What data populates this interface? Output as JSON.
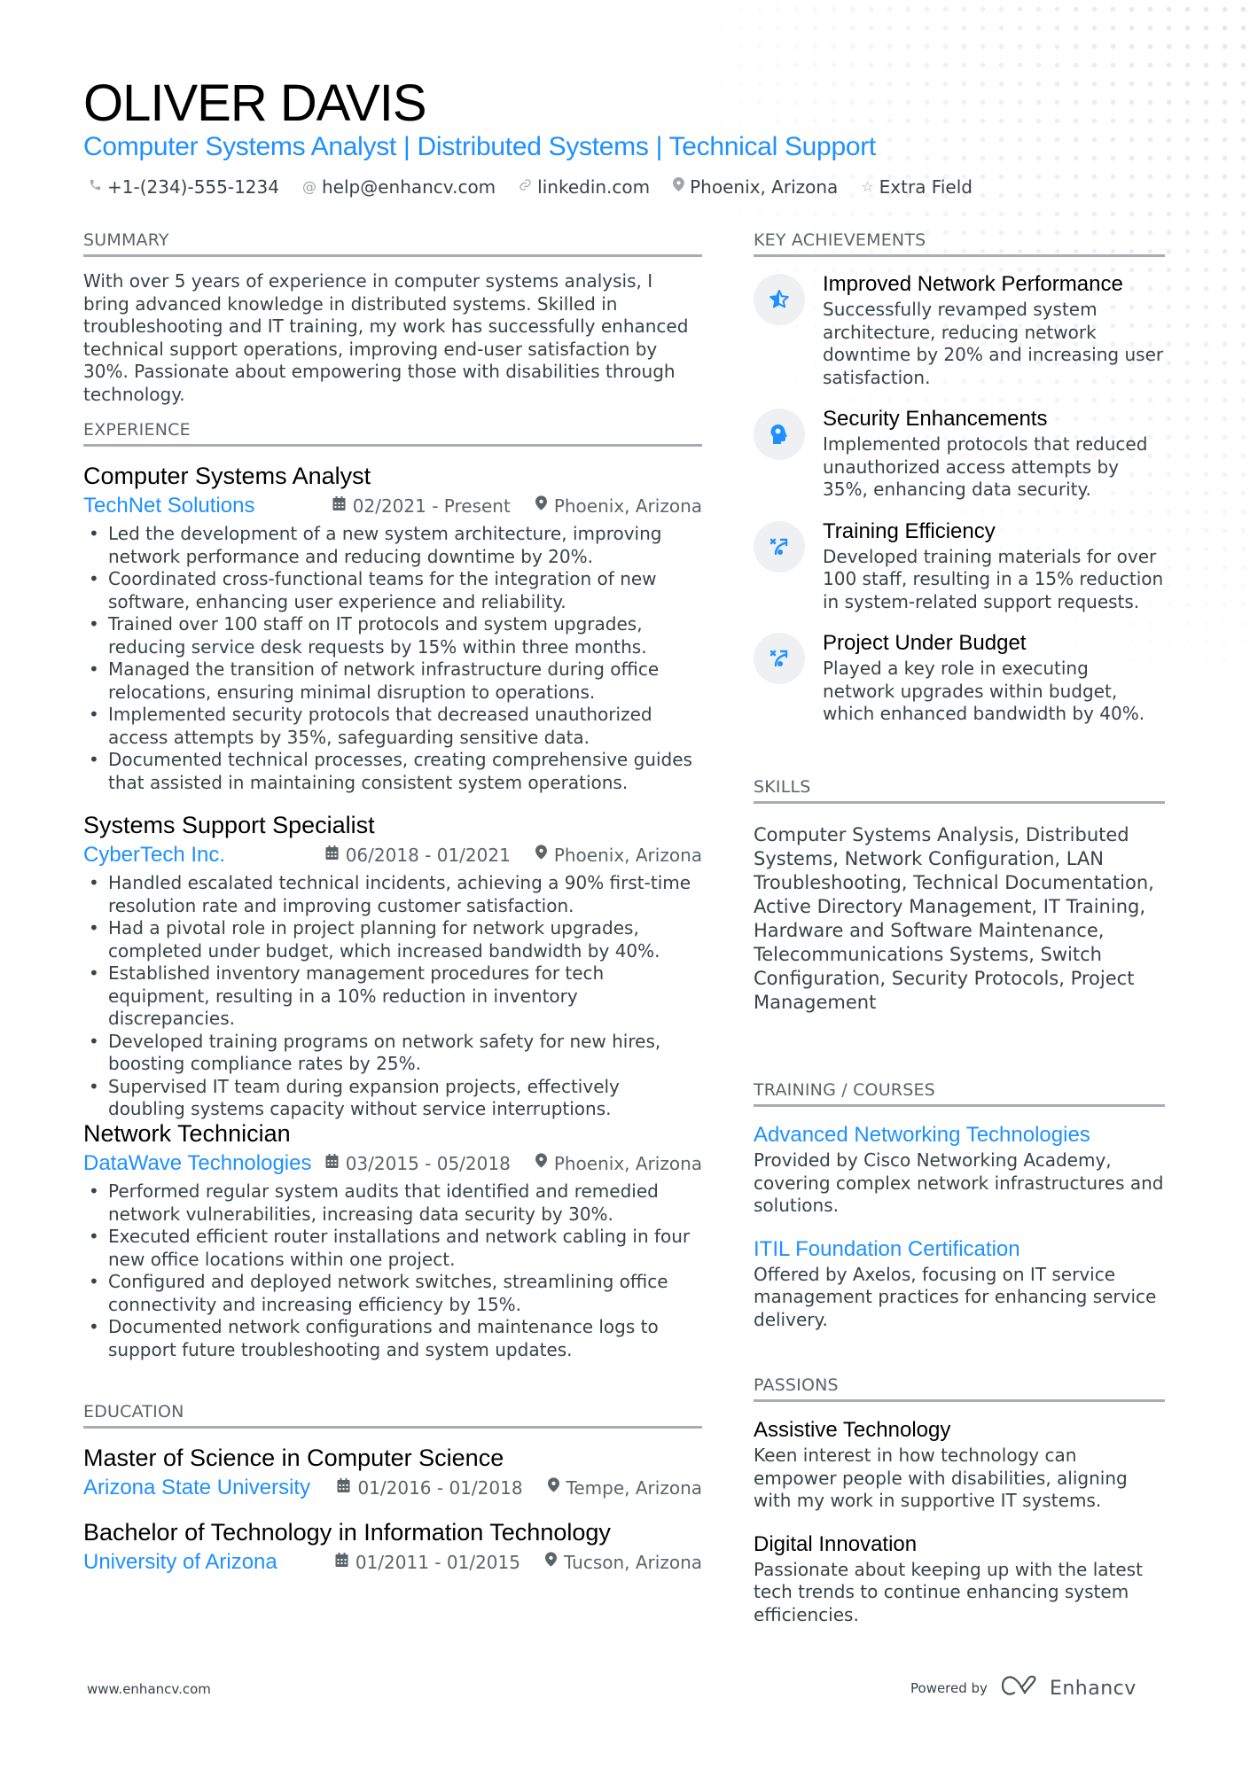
{
  "header": {
    "name": "OLIVER DAVIS",
    "headline": "Computer Systems Analyst | Distributed Systems | Technical Support",
    "contacts": [
      {
        "icon": "phone-icon",
        "text": "+1-(234)-555-1234"
      },
      {
        "icon": "at-icon",
        "text": "help@enhancv.com"
      },
      {
        "icon": "link-icon",
        "text": "linkedin.com"
      },
      {
        "icon": "location-icon",
        "text": "Phoenix, Arizona"
      },
      {
        "icon": "star-icon",
        "text": "Extra Field"
      }
    ]
  },
  "summary": {
    "heading": "SUMMARY",
    "text": "With over 5 years of experience in computer systems analysis, I bring advanced knowledge in distributed systems. Skilled in troubleshooting and IT training, my work has successfully enhanced technical support operations, improving end-user satisfaction by 30%. Passionate about empowering those with disabilities through technology."
  },
  "experience": {
    "heading": "EXPERIENCE",
    "jobs": [
      {
        "title": "Computer Systems Analyst",
        "company": "TechNet Solutions",
        "dates": "02/2021 - Present",
        "location": "Phoenix, Arizona",
        "bullets": [
          "Led the development of a new system architecture, improving network performance and reducing downtime by 20%.",
          "Coordinated cross-functional teams for the integration of new software, enhancing user experience and reliability.",
          "Trained over 100 staff on IT protocols and system upgrades, reducing service desk requests by 15% within three months.",
          "Managed the transition of network infrastructure during office relocations, ensuring minimal disruption to operations.",
          "Implemented security protocols that decreased unauthorized access attempts by 35%, safeguarding sensitive data.",
          "Documented technical processes, creating comprehensive guides that assisted in maintaining consistent system operations."
        ]
      },
      {
        "title": "Systems Support Specialist",
        "company": "CyberTech Inc.",
        "dates": "06/2018 - 01/2021",
        "location": "Phoenix, Arizona",
        "bullets": [
          "Handled escalated technical incidents, achieving a 90% first-time resolution rate and improving customer satisfaction.",
          "Had a pivotal role in project planning for network upgrades, completed under budget, which increased bandwidth by 40%.",
          "Established inventory management procedures for tech equipment, resulting in a 10% reduction in inventory discrepancies.",
          "Developed training programs on network safety for new hires, boosting compliance rates by 25%.",
          "Supervised IT team during expansion projects, effectively doubling systems capacity without service interruptions."
        ]
      },
      {
        "title": "Network Technician",
        "company": "DataWave Technologies",
        "dates": "03/2015 - 05/2018",
        "location": "Phoenix, Arizona",
        "bullets": [
          "Performed regular system audits that identified and remedied network vulnerabilities, increasing data security by 30%.",
          "Executed efficient router installations and network cabling in four new office locations within one project.",
          "Configured and deployed network switches, streamlining office connectivity and increasing efficiency by 15%.",
          "Documented network configurations and maintenance logs to support future troubleshooting and system updates."
        ]
      }
    ]
  },
  "education": {
    "heading": "EDUCATION",
    "items": [
      {
        "degree": "Master of Science in Computer Science",
        "school": "Arizona State University",
        "dates": "01/2016 - 01/2018",
        "location": "Tempe, Arizona"
      },
      {
        "degree": "Bachelor of Technology in Information Technology",
        "school": "University of Arizona",
        "dates": "01/2011 - 01/2015",
        "location": "Tucson, Arizona"
      }
    ]
  },
  "achievements": {
    "heading": "KEY ACHIEVEMENTS",
    "items": [
      {
        "icon": "half-star-icon",
        "title": "Improved Network Performance",
        "text": "Successfully revamped system architecture, reducing network downtime by 20% and increasing user satisfaction."
      },
      {
        "icon": "brain-head-icon",
        "title": "Security Enhancements",
        "text": "Implemented protocols that reduced unauthorized access attempts by 35%, enhancing data security."
      },
      {
        "icon": "strategy-icon",
        "title": "Training Efficiency",
        "text": "Developed training materials for over 100 staff, resulting in a 15% reduction in system-related support requests."
      },
      {
        "icon": "strategy-icon",
        "title": "Project Under Budget",
        "text": "Played a key role in executing network upgrades within budget, which enhanced bandwidth by 40%."
      }
    ]
  },
  "skills": {
    "heading": "SKILLS",
    "text": "Computer Systems Analysis, Distributed Systems, Network Configuration, LAN Troubleshooting, Technical Documentation, Active Directory Management, IT Training, Hardware and Software Maintenance, Telecommunications Systems, Switch Configuration, Security Protocols, Project Management"
  },
  "training": {
    "heading": "TRAINING / COURSES",
    "items": [
      {
        "title": "Advanced Networking Technologies",
        "text": "Provided by Cisco Networking Academy, covering complex network infrastructures and solutions."
      },
      {
        "title": "ITIL Foundation Certification",
        "text": "Offered by Axelos, focusing on IT service management practices for enhancing service delivery."
      }
    ]
  },
  "passions": {
    "heading": "PASSIONS",
    "items": [
      {
        "title": "Assistive Technology",
        "text": "Keen interest in how technology can empower people with disabilities, aligning with my work in supportive IT systems."
      },
      {
        "title": "Digital Innovation",
        "text": "Passionate about keeping up with the latest tech trends to continue enhancing system efficiencies."
      }
    ]
  },
  "footer": {
    "website": "www.enhancv.com",
    "powered_by": "Powered by",
    "brand": "Enhancv"
  },
  "colors": {
    "accent": "#1e90ff",
    "text": "#384347",
    "rule": "#a9adb0"
  }
}
